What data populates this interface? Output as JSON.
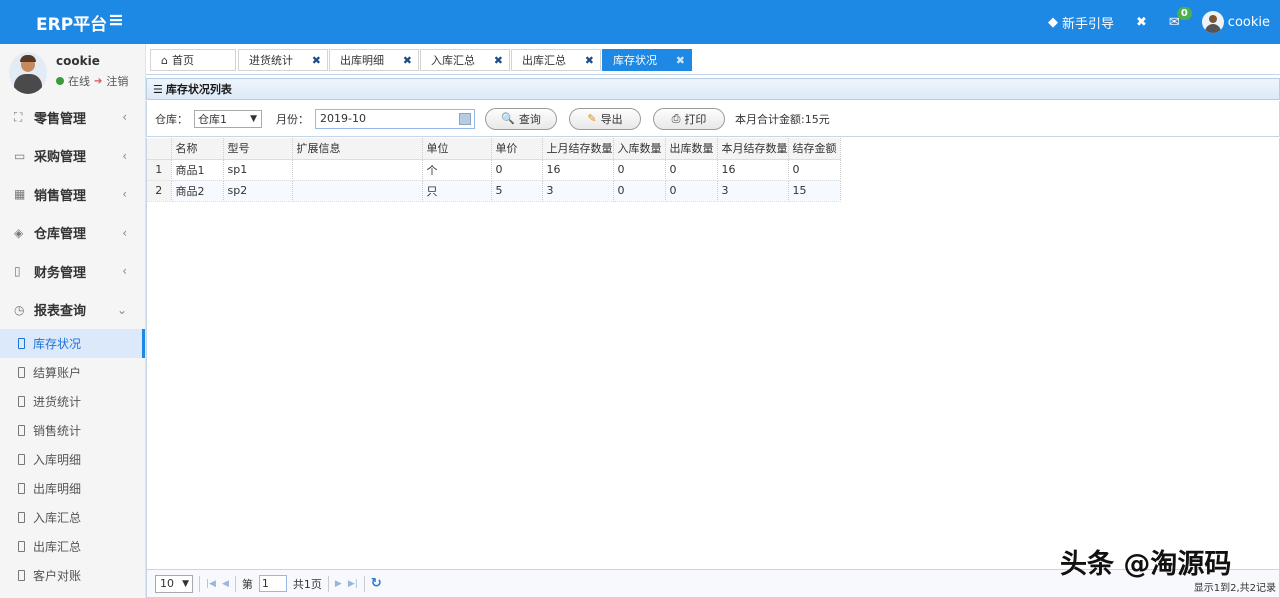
{
  "header": {
    "brand": "ERP平台",
    "menu_toggle_icon": "hamburger-icon",
    "guide_label": "新手引导",
    "notification_count": "0",
    "user_name": "cookie"
  },
  "sidebar": {
    "user": {
      "name": "cookie",
      "status": "在线",
      "logout": "注销"
    },
    "menus": [
      {
        "label": "零售管理",
        "icon": "gift-icon"
      },
      {
        "label": "采购管理",
        "icon": "monitor-icon"
      },
      {
        "label": "销售管理",
        "icon": "calendar-icon"
      },
      {
        "label": "仓库管理",
        "icon": "layers-icon"
      },
      {
        "label": "财务管理",
        "icon": "book-icon"
      },
      {
        "label": "报表查询",
        "icon": "clock-icon",
        "expanded": true
      }
    ],
    "report_items": [
      "库存状况",
      "结算账户",
      "进货统计",
      "销售统计",
      "入库明细",
      "出库明细",
      "入库汇总",
      "出库汇总",
      "客户对账"
    ],
    "active_item": "库存状况"
  },
  "tabs": [
    {
      "label": "首页",
      "icon": "home-icon"
    },
    {
      "label": "进货统计"
    },
    {
      "label": "出库明细"
    },
    {
      "label": "入库汇总"
    },
    {
      "label": "出库汇总"
    },
    {
      "label": "库存状况",
      "active": true
    }
  ],
  "panel": {
    "title": "库存状况列表",
    "warehouse_label": "仓库：",
    "warehouse_value": "仓库1",
    "month_label": "月份：",
    "month_value": "2019-10",
    "query_label": "查询",
    "export_label": "导出",
    "print_label": "打印",
    "total_text": "本月合计金额:15元"
  },
  "table": {
    "columns": [
      "名称",
      "型号",
      "扩展信息",
      "单位",
      "单价",
      "上月结存数量",
      "入库数量",
      "出库数量",
      "本月结存数量",
      "结存金额"
    ],
    "rows": [
      {
        "n": "1",
        "cells": [
          "商品1",
          "sp1",
          "",
          "个",
          "0",
          "16",
          "0",
          "0",
          "16",
          "0"
        ]
      },
      {
        "n": "2",
        "cells": [
          "商品2",
          "sp2",
          "",
          "只",
          "5",
          "3",
          "0",
          "0",
          "3",
          "15"
        ]
      }
    ]
  },
  "pager": {
    "page_size": "10",
    "page_prefix": "第",
    "page_value": "1",
    "page_suffix": "共1页",
    "info": "显示1到2,共2记录"
  },
  "watermark": "头条 @淘源码"
}
